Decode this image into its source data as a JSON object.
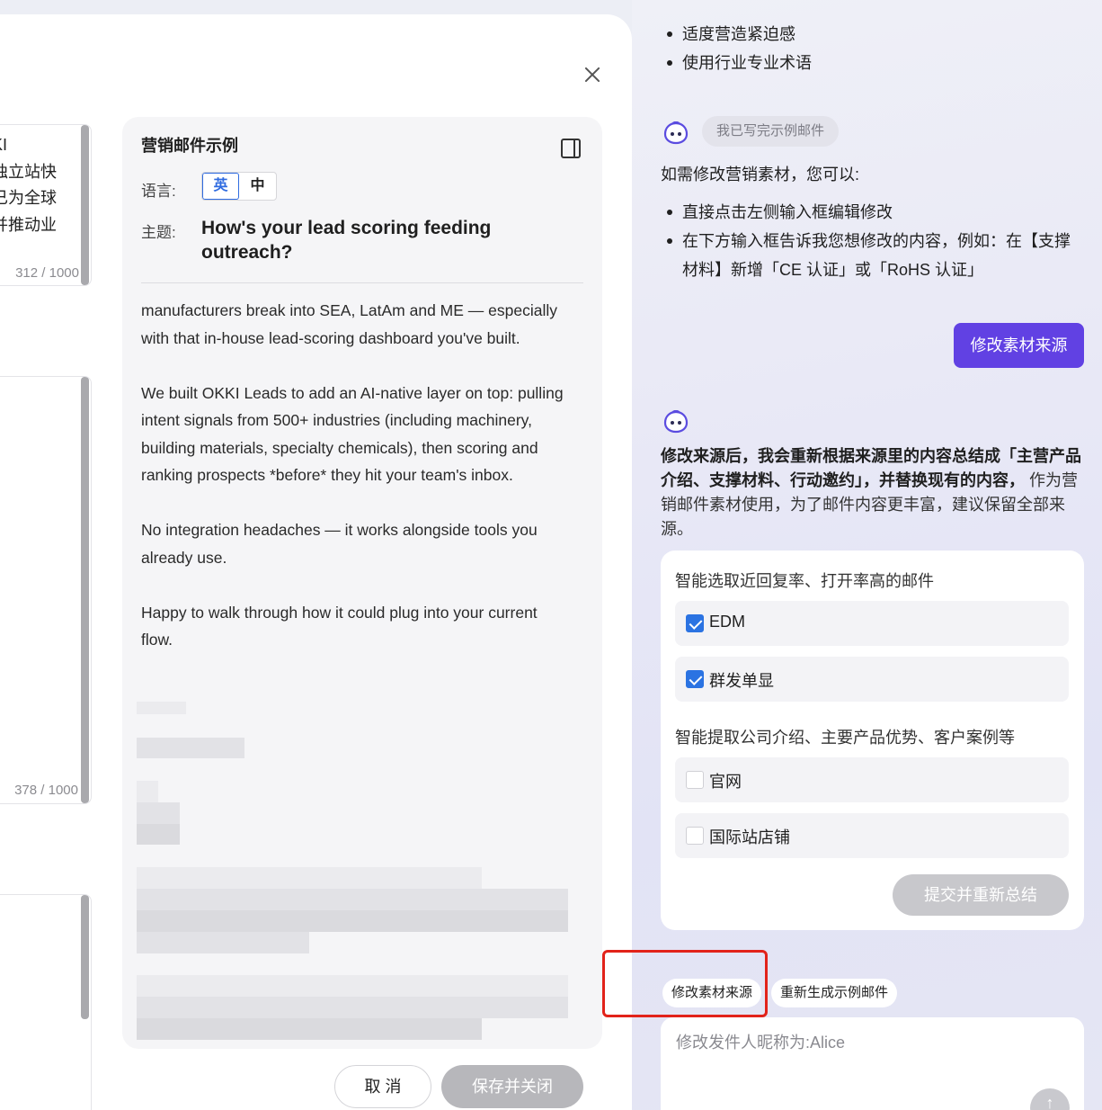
{
  "modal": {
    "close_icon": "close-icon",
    "side_cards": [
      {
        "text": "KI\n独立站快\n已为全球\n并推动业",
        "count": "312 / 1000"
      },
      {
        "text": "",
        "count": "378 / 1000"
      },
      {
        "text": "",
        "count": ""
      }
    ],
    "email": {
      "title": "营销邮件示例",
      "panel_icon": "panel-toggle-icon",
      "lang_label": "语言:",
      "lang_en": "英",
      "lang_zh": "中",
      "selected_lang": "英",
      "subject_label": "主题:",
      "subject": "How's your lead scoring feeding outreach?",
      "paragraphs": [
        "manufacturers break into SEA, LatAm and ME — especially with that in-house lead-scoring dashboard you've built.",
        "We built OKKI Leads to add an AI-native layer on top: pulling intent signals from 500+ industries (including machinery, building materials, specialty chemicals), then scoring and ranking prospects *before* they hit your team's inbox.",
        "No integration headaches — it works alongside tools you already use.",
        "Happy to walk through how it could plug into your current flow."
      ]
    },
    "cancel_label": "取 消",
    "save_label": "保存并关闭"
  },
  "chat": {
    "top_bullets": [
      "适度营造紧迫感",
      "使用行业专业术语"
    ],
    "bot_icon": "bot-avatar-icon",
    "status_pill": "我已写完示例邮件",
    "intro": "如需修改营销素材，您可以:",
    "tips": [
      "直接点击左侧输入框编辑修改",
      "在下方输入框告诉我您想修改的内容，例如：在【支撑材料】新增「CE 认证」或「RoHS 认证」"
    ],
    "modify_button": "修改素材来源",
    "info_bold": "修改来源后，我会重新根据来源里的内容总结成「主营产品介绍、支撑材料、行动邀约」，并替换现有的内容，",
    "info_rest": " 作为营销邮件素材使用，为了邮件内容更丰富，建议保留全部来源。",
    "section1_title": "智能选取近回复率、打开率高的邮件",
    "section1_options": [
      {
        "label": "EDM",
        "checked": true
      },
      {
        "label": "群发单显",
        "checked": true
      }
    ],
    "section2_title": "智能提取公司介绍、主要产品优势、客户案例等",
    "section2_options": [
      {
        "label": "官网",
        "checked": false
      },
      {
        "label": "国际站店铺",
        "checked": false
      }
    ],
    "submit_button": "提交并重新总结",
    "chips": [
      "修改素材来源",
      "重新生成示例邮件"
    ],
    "input_placeholder": "修改发件人昵称为:Alice",
    "send_icon": "send-arrow-icon",
    "highlight_color": "#e2231a",
    "accent_color": "#6141e3"
  }
}
